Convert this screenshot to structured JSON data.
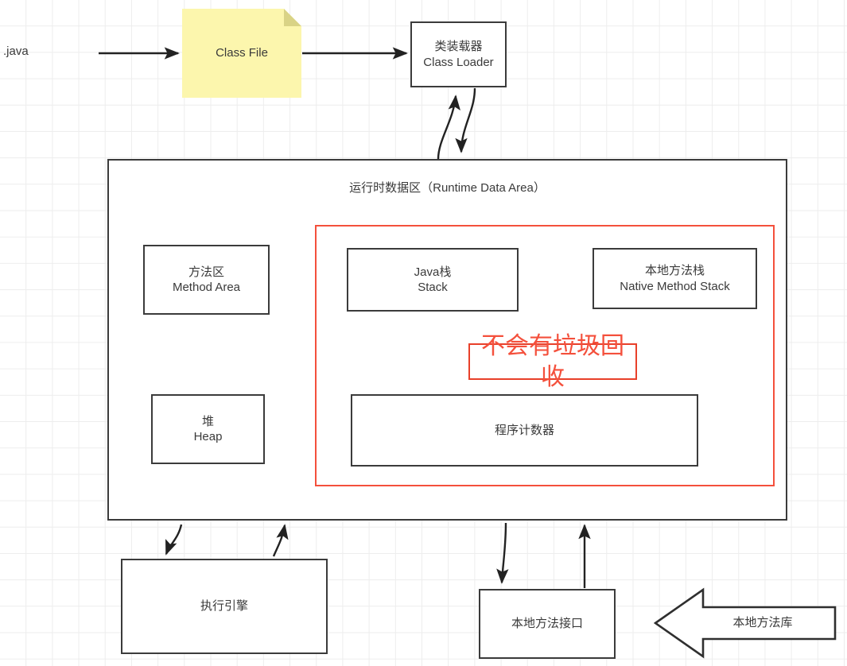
{
  "diagram": {
    "title": "JVM Runtime Architecture",
    "background": {
      "grid_color": "#ededed",
      "page_color": "#ffffff"
    },
    "colors": {
      "box_border": "#3b3b3b",
      "text": "#3a3a3a",
      "note_fill": "#fcf6ad",
      "note_fold": "#d9d386",
      "accent_red": "#f4503c",
      "arrow": "#222222"
    },
    "nodes": {
      "java_source_label": ".java",
      "class_file": "Class File",
      "class_loader": "类装载器\nClass Loader",
      "runtime_data_area_title": "运行时数据区（Runtime Data Area）",
      "method_area": "方法区\nMethod Area",
      "heap": "堆\nHeap",
      "java_stack": "Java栈\nStack",
      "native_method_stack": "本地方法栈\nNative Method Stack",
      "pc_register": "程序计数器",
      "gc_free_note": "不会有垃圾回收",
      "execution_engine": "执行引擎",
      "native_method_interface": "本地方法接口",
      "native_method_library": "本地方法库"
    }
  }
}
